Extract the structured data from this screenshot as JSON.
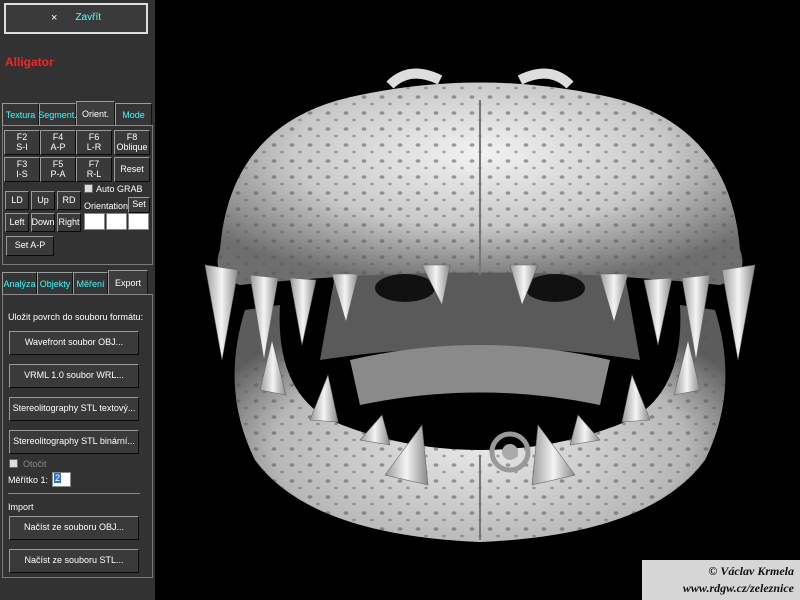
{
  "close_button": {
    "icon": "×",
    "label": "Zavřít"
  },
  "title": "Alligator",
  "top_tabs": [
    "Textura",
    "Segment.",
    "Orient.",
    "Mode"
  ],
  "orient": {
    "keys": [
      {
        "key": "F2",
        "sub": "S-I"
      },
      {
        "key": "F4",
        "sub": "A-P"
      },
      {
        "key": "F6",
        "sub": "L-R"
      },
      {
        "key": "F8",
        "sub": "Oblique"
      },
      {
        "key": "F3",
        "sub": "I-S"
      },
      {
        "key": "F5",
        "sub": "P-A"
      },
      {
        "key": "F7",
        "sub": "R-L"
      }
    ],
    "reset": "Reset",
    "nav": [
      "LD",
      "Up",
      "RD",
      "Left",
      "Down",
      "Right"
    ],
    "auto_grab": "Auto GRAB",
    "orientation_label": "Orientation:",
    "set": "Set",
    "set_ap": "Set A-P"
  },
  "bottom_tabs": [
    "Analýza",
    "Objekty",
    "Měření",
    "Export"
  ],
  "export": {
    "heading": "Uložit povrch do souboru formátu:",
    "buttons": [
      "Wavefront soubor OBJ...",
      "VRML 1.0 soubor WRL...",
      "Stereolitography STL textový...",
      "Stereolitography STL binární..."
    ],
    "otocit": "Otočit",
    "scale_label": "Měřítko 1:",
    "scale_value": "2"
  },
  "import": {
    "heading": "Import",
    "buttons": [
      "Načíst ze souboru OBJ...",
      "Načíst ze souboru STL..."
    ]
  },
  "credit": {
    "line1": "© Václav Krmela",
    "line2": "www.rdgw.cz/zeleznice"
  },
  "colors": {
    "title": "#ff2020",
    "tab_text": "#33ffff",
    "panel_bg": "#323232",
    "viewport_bg": "#000000"
  }
}
